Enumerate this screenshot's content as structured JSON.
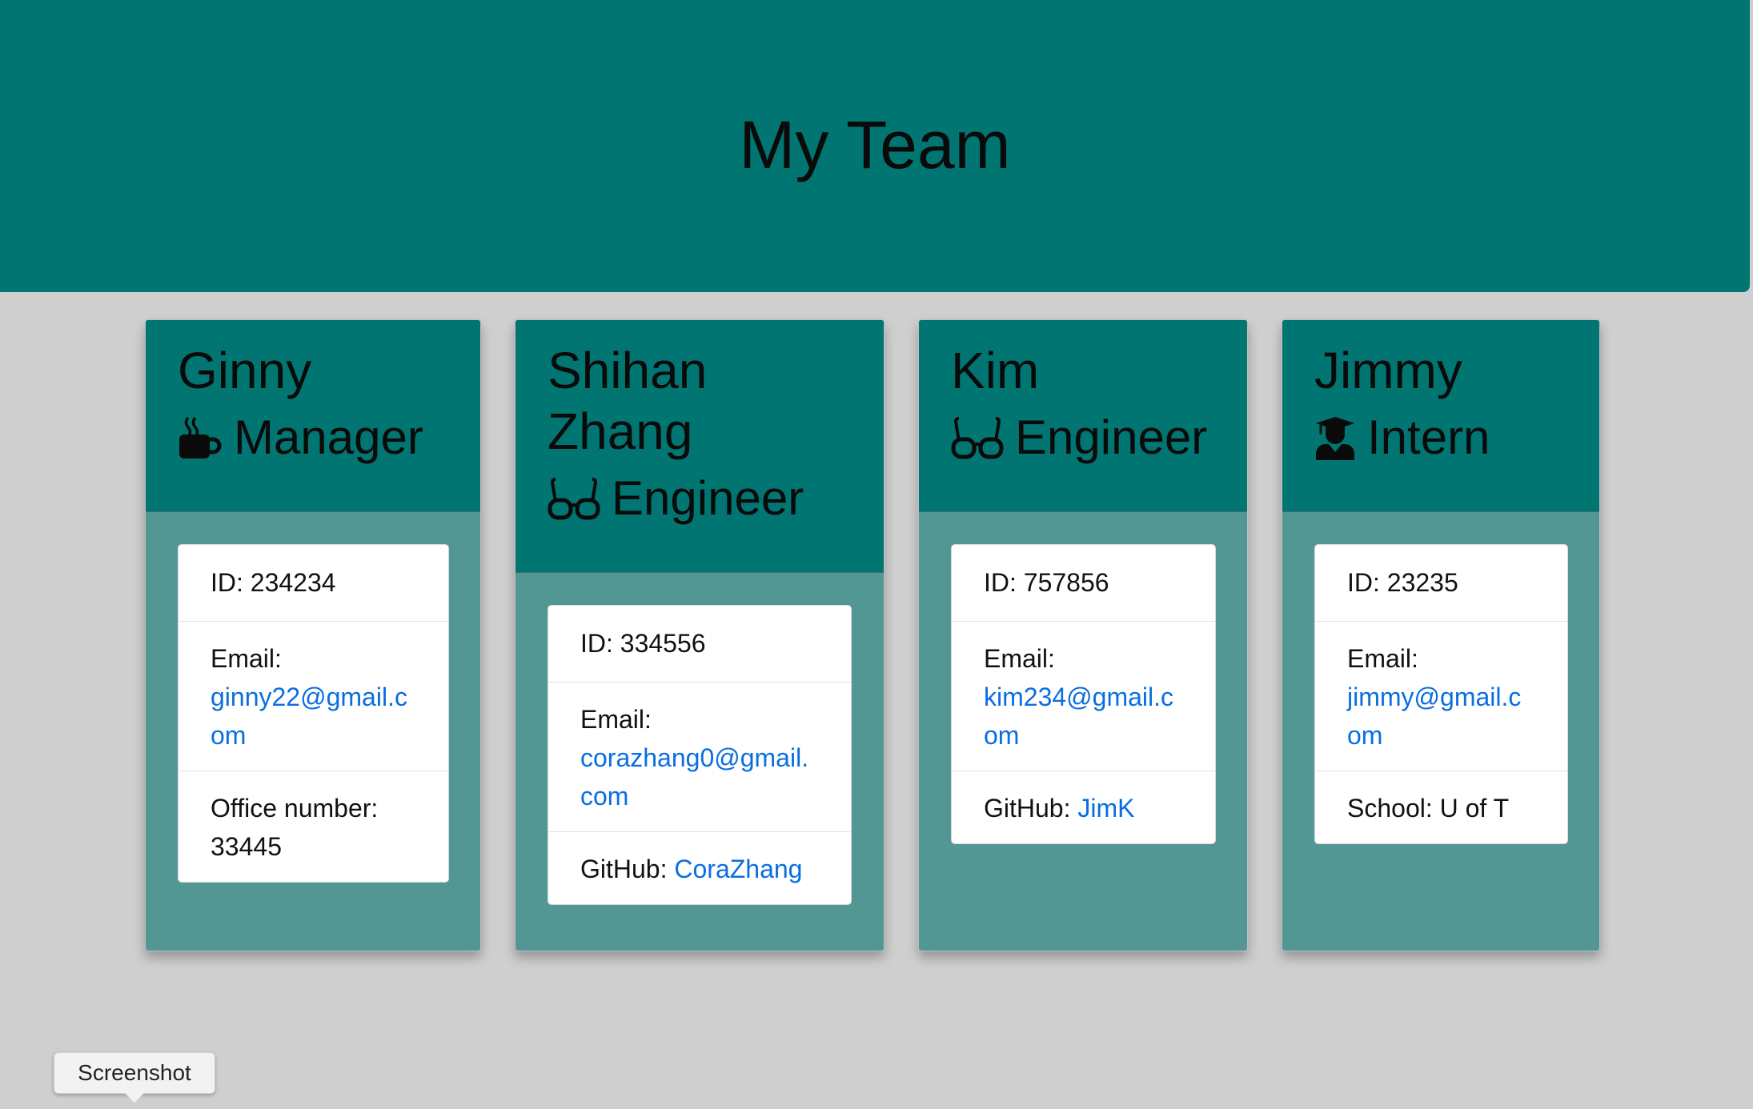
{
  "header": {
    "title": "My Team"
  },
  "cards": [
    {
      "name": "Ginny",
      "role": "Manager",
      "role_icon": "coffee-icon",
      "id_line": "ID: 234234",
      "email_label": "Email:",
      "email": "ginny22@gmail.com",
      "extra_label": "Office number:",
      "extra_value": "33445"
    },
    {
      "name": "Shihan Zhang",
      "role": "Engineer",
      "role_icon": "glasses-icon",
      "id_line": "ID: 334556",
      "email_label": "Email:",
      "email": "corazhang0@gmail.com",
      "extra_label": "GitHub:",
      "extra_value": "CoraZhang"
    },
    {
      "name": "Kim",
      "role": "Engineer",
      "role_icon": "glasses-icon",
      "id_line": "ID: 757856",
      "email_label": "Email:",
      "email": "kim234@gmail.com",
      "extra_label": "GitHub:",
      "extra_value": "JimK"
    },
    {
      "name": "Jimmy",
      "role": "Intern",
      "role_icon": "graduate-icon",
      "id_line": "ID: 23235",
      "email_label": "Email:",
      "email": "jimmy@gmail.com",
      "extra_label": "School:",
      "extra_value": "U of T"
    }
  ],
  "tooltip": {
    "label": "Screenshot"
  },
  "colors": {
    "header_bg": "#017572",
    "card_body_bg": "#529794",
    "page_bg": "#cfcfcf",
    "link": "#0a6ee0"
  }
}
